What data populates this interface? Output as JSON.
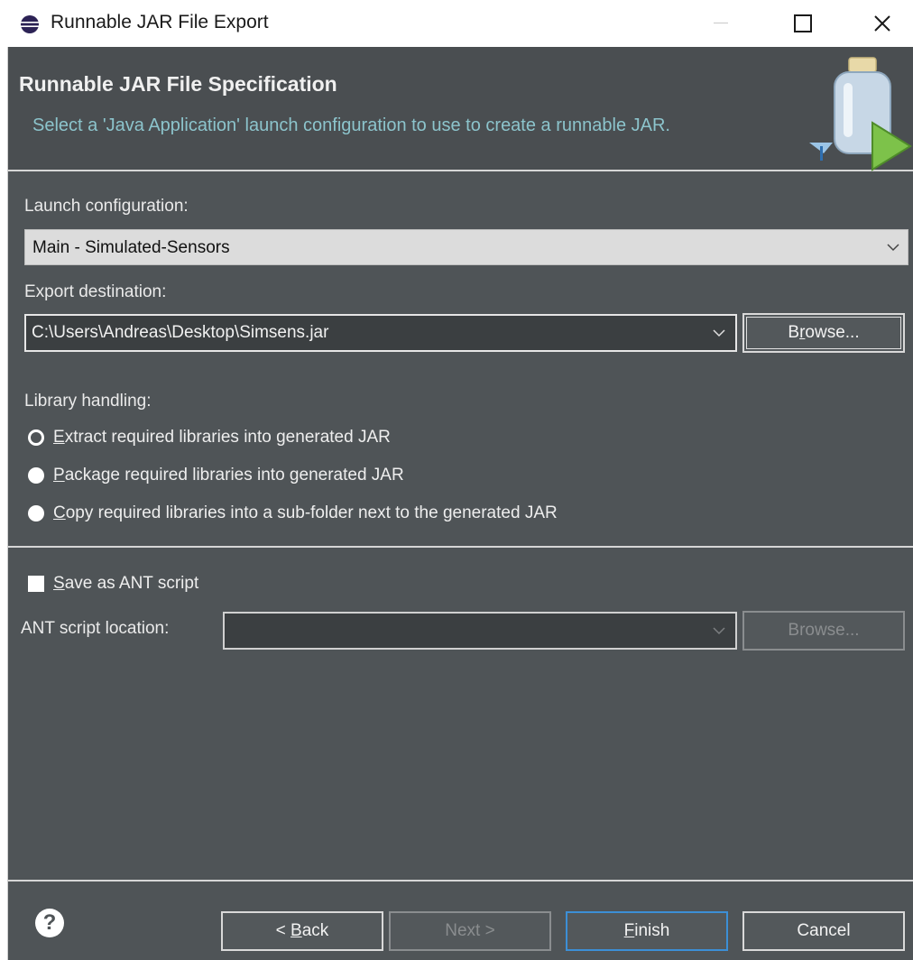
{
  "window": {
    "title": "Runnable JAR File Export"
  },
  "banner": {
    "title": "Runnable JAR File Specification",
    "description": "Select a 'Java Application' launch configuration to use to create a runnable JAR."
  },
  "launch": {
    "label": "Launch configuration:",
    "selected": "Main - Simulated-Sensors"
  },
  "export": {
    "label": "Export destination:",
    "value": "C:\\Users\\Andreas\\Desktop\\Simsens.jar",
    "browse_prefix": "B",
    "browse_mnemonic": "r",
    "browse_suffix": "owse..."
  },
  "library": {
    "label": "Library handling:",
    "options": [
      {
        "mnemonic": "E",
        "rest": "xtract required libraries into generated JAR",
        "selected": true
      },
      {
        "mnemonic": "P",
        "rest": "ackage required libraries into generated JAR",
        "selected": false
      },
      {
        "mnemonic": "C",
        "rest": "opy required libraries into a sub-folder next to the generated JAR",
        "selected": false
      }
    ]
  },
  "ant": {
    "checkbox_mnemonic": "S",
    "checkbox_rest": "ave as ANT script",
    "checked": false,
    "location_label": "ANT script location:",
    "location_value": "",
    "browse_label": "Browse..."
  },
  "footer": {
    "help_glyph": "?",
    "back_prefix": "< ",
    "back_mnemonic": "B",
    "back_rest": "ack",
    "next_label": "Next >",
    "finish_mnemonic": "F",
    "finish_rest": "inish",
    "cancel_label": "Cancel"
  },
  "colors": {
    "dialog_bg": "#4f5457",
    "banner_bg": "#4a4e51",
    "banner_desc": "#8cc4cc",
    "default_button_border": "#3c8fd6"
  }
}
